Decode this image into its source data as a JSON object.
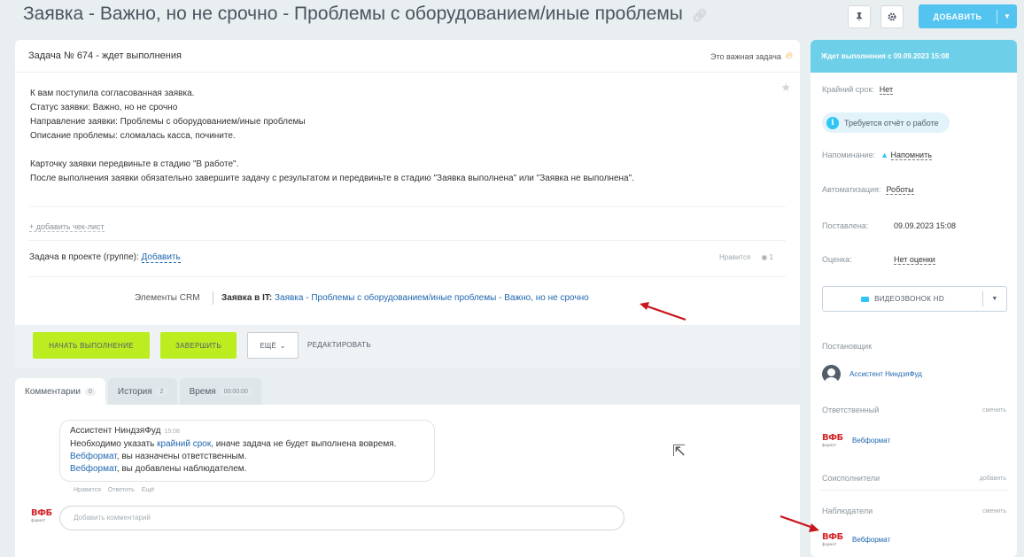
{
  "header": {
    "title": "Заявка - Важно, но не срочно - Проблемы с оборудованием/иные проблемы",
    "add_label": "ДОБАВИТЬ"
  },
  "task": {
    "number_status": "Задача № 674 - ждет выполнения",
    "important_label": "Это важная задача",
    "description": [
      "К вам поступила согласованная заявка.",
      "Статус заявки: Важно, но не срочно",
      "Направление заявки: Проблемы  с оборудованием/иные проблемы",
      "Описание проблемы: сломалась касса, почините.",
      "",
      "Карточку заявки передвиньте в стадию \"В работе\".",
      "После выполнения заявки обязательно завершите задачу с результатом и передвиньте в стадию \"Заявка выполнена\" или \"Заявка не выполнена\"."
    ],
    "add_checklist": "+ добавить чек-лист",
    "project_label": "Задача в проекте (группе):",
    "project_link": "Добавить",
    "like_label": "Нравится",
    "views": "1",
    "crm_label": "Элементы CRM",
    "crm_type": "Заявка в IT:",
    "crm_link": "Заявка - Проблемы с оборудованием/иные проблемы - Важно, но не срочно",
    "buttons": {
      "start": "НАЧАТЬ ВЫПОЛНЕНИЕ",
      "finish": "ЗАВЕРШИТЬ",
      "more": "ЕЩЁ",
      "edit": "РЕДАКТИРОВАТЬ"
    }
  },
  "tabs": [
    {
      "label": "Комментарии",
      "count": "0"
    },
    {
      "label": "История",
      "count": "2"
    },
    {
      "label": "Время",
      "count": "00:00:00"
    }
  ],
  "comment": {
    "author": "Ассистент НиндзяФуд",
    "time": "15:08",
    "line1_pre": "Необходимо указать ",
    "line1_link": "крайний срок",
    "line1_post": ", иначе задача не будет выполнена вовремя.",
    "line2_link": "Вебформат",
    "line2_post": ", вы назначены ответственным.",
    "line3_link": "Вебформат",
    "line3_post": ", вы добавлены наблюдателем.",
    "actions": [
      "Нравится",
      "Ответить",
      "Ещё"
    ],
    "input_placeholder": "Добавить комментарий"
  },
  "sidebar": {
    "status": "Ждет выполнения с 09.09.2023 15:08",
    "deadline_label": "Крайний срок:",
    "deadline_value": "Нет",
    "report_pill": "Требуется отчёт о работе",
    "reminder_label": "Напоминание:",
    "reminder_value": "Напомнить",
    "automation_label": "Автоматизация:",
    "automation_value": "Роботы",
    "created_label": "Поставлена:",
    "created_value": "09.09.2023 15:08",
    "rating_label": "Оценка:",
    "rating_value": "Нет оценки",
    "video_label": "ВИДЕОЗВОНОК HD",
    "creator_label": "Постановщик",
    "creator_name": "Ассистент НиндзяФуд",
    "responsible_label": "Ответственный",
    "change_label": "сменить",
    "responsible_name": "Вебформат",
    "co_label": "Соисполнители",
    "add_label": "добавить",
    "observers_label": "Наблюдатели",
    "observer_name": "Вебформат"
  },
  "avatar_brand": {
    "big": "ВФБ",
    "small": "формат"
  },
  "colors": {
    "accent": "#bbed21",
    "status": "#6ecfe8",
    "link": "#2067b0",
    "arrow": "#c8161d"
  }
}
